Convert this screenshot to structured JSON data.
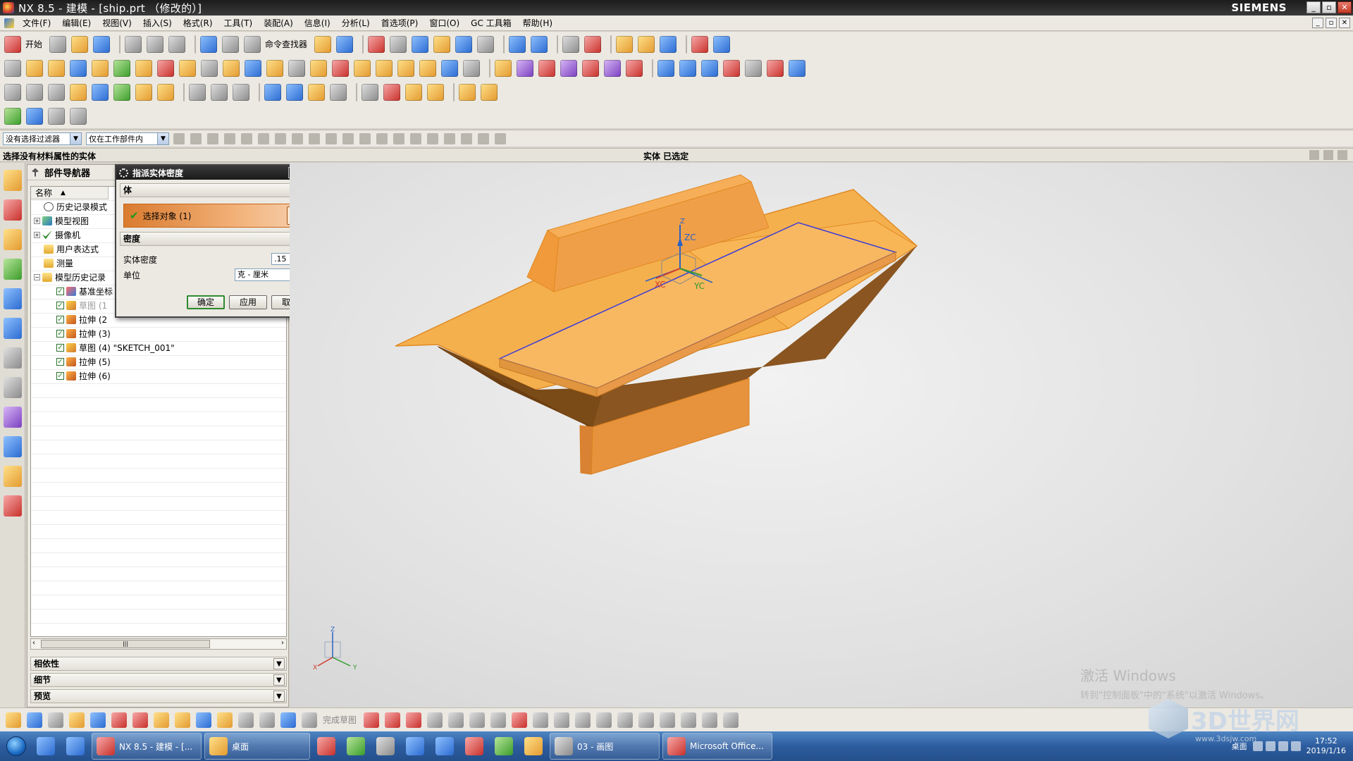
{
  "window": {
    "title": "NX 8.5 - 建模 - [ship.prt  （修改的）]",
    "brand": "SIEMENS",
    "controls": [
      "_",
      "▫",
      "✕"
    ]
  },
  "menu": {
    "items": [
      "文件(F)",
      "编辑(E)",
      "视图(V)",
      "插入(S)",
      "格式(R)",
      "工具(T)",
      "装配(A)",
      "信息(I)",
      "分析(L)",
      "首选项(P)",
      "窗口(O)",
      "GC 工具箱",
      "帮助(H)"
    ]
  },
  "toolbar": {
    "start_label": "开始",
    "command_finder_label": "命令查找器"
  },
  "filterbar": {
    "type_filter": "没有选择过滤器",
    "scope_filter": "仅在工作部件内"
  },
  "statusbar": {
    "prompt": "选择没有材料属性的实体",
    "status": "实体  已选定"
  },
  "navigator": {
    "title": "部件导航器",
    "column_name": "名称",
    "tree": [
      {
        "label": "历史记录模式",
        "icon": "clock-icon"
      },
      {
        "label": "模型视图",
        "icon": "model-view-icon"
      },
      {
        "label": "摄像机",
        "icon": "camera-icon"
      },
      {
        "label": "用户表达式",
        "icon": "folder-icon"
      },
      {
        "label": "测量",
        "icon": "folder-icon"
      },
      {
        "label": "模型历史记录",
        "icon": "folder-icon"
      }
    ],
    "features": [
      {
        "label": "基准坐标",
        "icon": "datum-csys-icon"
      },
      {
        "label": "草图 (1",
        "icon": "sketch-icon"
      },
      {
        "label": "拉伸 (2",
        "icon": "extrude-icon"
      },
      {
        "label": "拉伸 (3)",
        "icon": "extrude-icon"
      },
      {
        "label": "草图 (4) \"SKETCH_001\"",
        "icon": "sketch-icon"
      },
      {
        "label": "拉伸 (5)",
        "icon": "extrude-icon"
      },
      {
        "label": "拉伸 (6)",
        "icon": "extrude-icon"
      }
    ],
    "panels": [
      "相依性",
      "细节",
      "预览"
    ]
  },
  "dialog": {
    "title": "指派实体密度",
    "section_body": "体",
    "select_object": "选择对象 (1)",
    "section_density": "密度",
    "density_label": "实体密度",
    "density_value": ".15",
    "unit_label": "单位",
    "unit_value": "克 - 厘米",
    "ok": "确定",
    "apply": "应用",
    "cancel": "取消"
  },
  "viewport": {
    "axis_labels": {
      "zc": "ZC",
      "yc": "YC",
      "xc": "XC",
      "z": "Z",
      "y": "Y",
      "x": "X"
    },
    "watermark_title": "激活 Windows",
    "watermark_text": "转到\"控制面板\"中的\"系统\"以激活 Windows。",
    "logo_text": "3D世界网",
    "logo_url": "www.3dsjw.com",
    "model_color": "#f5a742"
  },
  "bottombar": {
    "sketch_done": "完成草图"
  },
  "taskbar": {
    "tasks": [
      {
        "label": "NX 8.5 - 建模 - [..."
      },
      {
        "label": "桌面"
      },
      {
        "label": "03 - 画图"
      },
      {
        "label": "Microsoft Office..."
      }
    ],
    "desktop_label": "桌面",
    "time": "17:52",
    "date": "2019/1/16"
  }
}
